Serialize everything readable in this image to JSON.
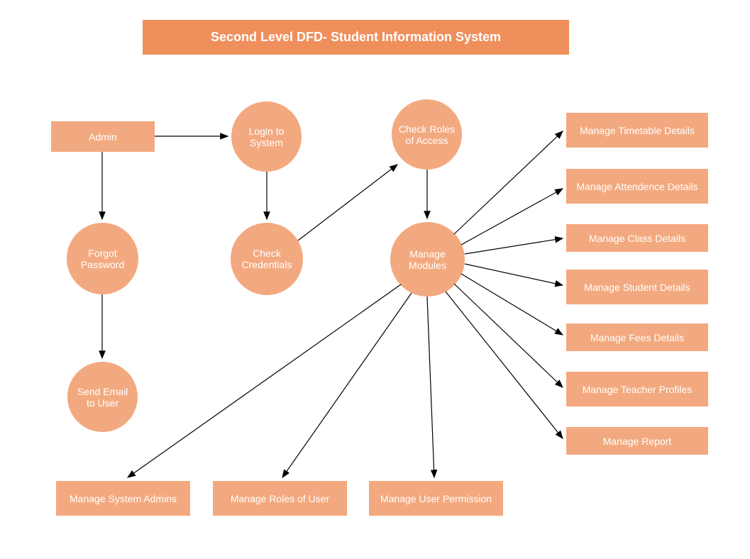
{
  "title": "Second Level DFD- Student Information System",
  "nodes": {
    "admin": "Admin",
    "login": "Login to System",
    "roles": "Check Roles of Access",
    "forgot": "Forgot Password",
    "credentials": "Check Credentials",
    "modules": "Manage Modules",
    "send_email": "Send Email to User",
    "sys_admins": "Manage System Admins",
    "roles_user": "Manage Roles of User",
    "user_perm": "Manage User Permission",
    "timetable": "Manage Timetable Details",
    "attendance": "Manage Attendence Details",
    "class": "Manage Class Details",
    "student": "Manage Student Details",
    "fees": "Manage Fees Details",
    "teacher": "Manage Teacher Profiles",
    "report": "Manage Report"
  }
}
